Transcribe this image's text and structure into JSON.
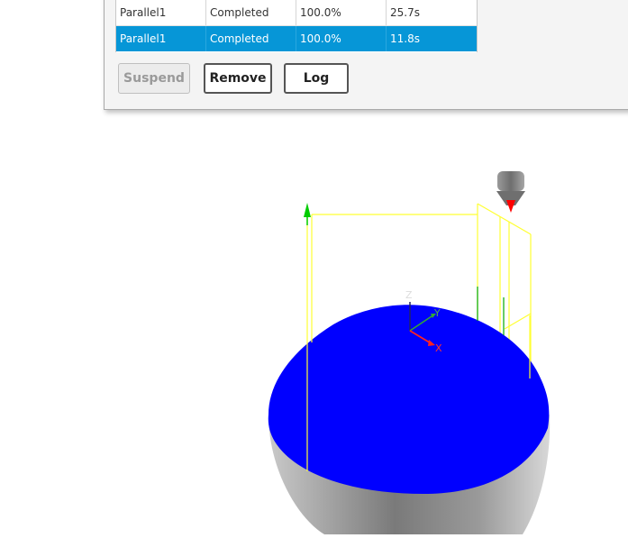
{
  "ops_table": {
    "rows": [
      {
        "name": "Parallel1",
        "status": "Completed",
        "progress": "100.0%",
        "time": "25.7s",
        "selected": false
      },
      {
        "name": "Parallel1",
        "status": "Completed",
        "progress": "100.0%",
        "time": "11.8s",
        "selected": true
      }
    ]
  },
  "buttons": {
    "suspend_label": "Suspend",
    "remove_label": "Remove",
    "log_label": "Log"
  },
  "viewport": {
    "triad": {
      "z_label": "Z",
      "y_label": "Y",
      "x_label": "X"
    },
    "colors": {
      "surface": "#0000ff",
      "stock_box": "#ffff33",
      "origin_arrow": "#00cc00",
      "tool_tip": "#ff0000",
      "x_axis": "#ff2222",
      "y_axis": "#33aa33",
      "z_axis": "#222266"
    },
    "icons": [
      "tool-holder-icon",
      "origin-up-arrow-icon",
      "view-triad-icon"
    ]
  }
}
